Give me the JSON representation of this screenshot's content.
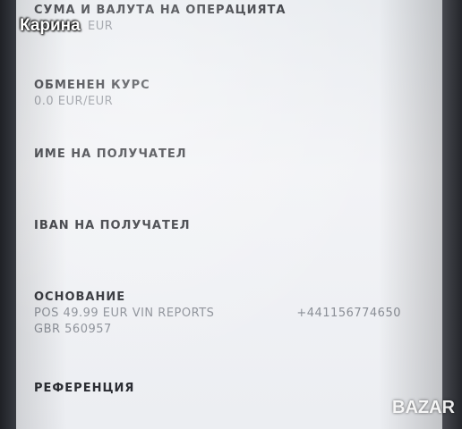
{
  "watermark_user": "Карина",
  "watermark_site": "BAZAR",
  "fields": {
    "amount": {
      "label": "СУМА И ВАЛУТА НА ОПЕРАЦИЯТА",
      "value": "EUR"
    },
    "exchange_rate": {
      "label": "ОБМЕНЕН КУРС",
      "value": "0.0 EUR/EUR"
    },
    "recipient_name": {
      "label": "ИМЕ НА ПОЛУЧАТЕЛ"
    },
    "recipient_iban": {
      "label": "IBAN НА ПОЛУЧАТЕЛ"
    },
    "basis": {
      "label": "ОСНОВАНИЕ",
      "line1": "POS 49.99 EUR VIN REPORTS",
      "phone": "+441156774650",
      "line2": "GBR 560957"
    },
    "reference": {
      "label": "РЕФЕРЕНЦИЯ"
    }
  },
  "colors": {
    "label": "#2b2d33",
    "value": "#8a8e96",
    "screen": "#eef0f3"
  }
}
